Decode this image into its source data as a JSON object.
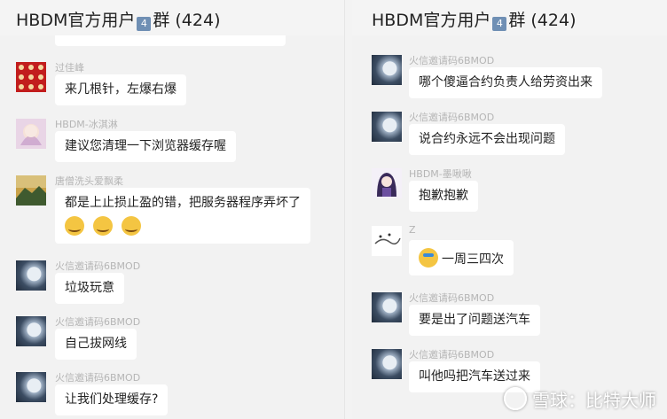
{
  "left_panel": {
    "title": "HBDM官方用户",
    "badge": "4",
    "suffix": "群 (424)",
    "messages": [
      {
        "sender": "过佳峰",
        "text": "来几根针，左爆右爆",
        "avatar": "red-pattern-avatar"
      },
      {
        "sender": "HBDM-冰淇淋",
        "text": "建议您清理一下浏览器缓存喔",
        "avatar": "cartoon-girl-avatar"
      },
      {
        "sender": "唐僧洗头爱飘柔",
        "text": "都是上止损止盈的错，把服务器程序弄坏了",
        "emojis": [
          "laugh-cry-emoji",
          "laugh-cry-emoji",
          "laugh-cry-emoji"
        ],
        "avatar": "landscape-avatar"
      },
      {
        "sender": "火信邀请码6BMOD",
        "text": "垃圾玩意",
        "avatar": "moon-avatar"
      },
      {
        "sender": "火信邀请码6BMOD",
        "text": "自己拔网线",
        "avatar": "moon-avatar"
      },
      {
        "sender": "火信邀请码6BMOD",
        "text": "让我们处理缓存?",
        "avatar": "moon-avatar"
      }
    ]
  },
  "right_panel": {
    "title": "HBDM官方用户",
    "badge": "4",
    "suffix": "群 (424)",
    "messages": [
      {
        "sender": "火信邀请码6BMOD",
        "text": "哪个傻逼合约负责人给劳资出来",
        "avatar": "moon-avatar"
      },
      {
        "sender": "火信邀请码6BMOD",
        "text": "说合约永远不会出现问题",
        "avatar": "moon-avatar"
      },
      {
        "sender": "HBDM-墨啾啾",
        "text": "抱歉抱歉",
        "avatar": "anime-girl-avatar"
      },
      {
        "sender": "Z",
        "text": "一周三四次",
        "emoji": "sweat-emoji",
        "avatar": "sketch-avatar"
      },
      {
        "sender": "火信邀请码6BMOD",
        "text": "要是出了问题送汽车",
        "avatar": "moon-avatar"
      },
      {
        "sender": "火信邀请码6BMOD",
        "text": "叫他吗把汽车送过来",
        "avatar": "moon-avatar"
      }
    ]
  },
  "watermark": {
    "text": "雪球：比特大师"
  }
}
